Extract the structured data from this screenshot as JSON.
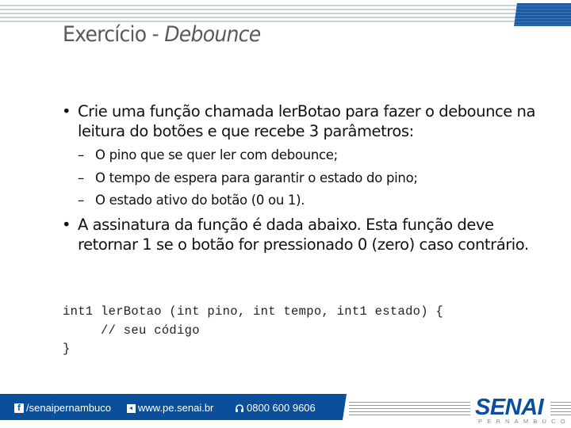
{
  "slide": {
    "title_prefix": "Exercício - ",
    "title_emphasis": "Debounce",
    "bullets": [
      {
        "symbol": "•",
        "text": "Crie uma função chamada lerBotao para fazer o debounce na leitura do botões e que recebe 3 parâmetros:",
        "subitems": [
          "O pino que se quer ler com debounce;",
          "O tempo de espera para garantir o estado do pino;",
          "O estado ativo do botão (0 ou 1)."
        ]
      },
      {
        "symbol": "•",
        "text": "A assinatura da função é dada abaixo. Esta função deve retornar 1 se o botão for pressionado 0 (zero) caso contrário."
      }
    ],
    "sub_symbol": "–",
    "code_lines": [
      "int1 lerBotao (int pino, int tempo, int1 estado) {",
      "     // seu código",
      "}"
    ]
  },
  "footer": {
    "facebook": {
      "icon": "facebook-icon",
      "glyph": "f",
      "label": "/senaipernambuco"
    },
    "website": {
      "icon": "web-icon",
      "label": "www.pe.senai.br"
    },
    "phone": {
      "icon": "headset-icon",
      "label": "0800 600 9606"
    },
    "logo": {
      "name": "SENAI",
      "subtitle": "PERNAMBUCO"
    }
  },
  "colors": {
    "brand_blue": "#0a4f9c",
    "stripe_grey": "#c8d3d6",
    "title_grey": "#595959"
  }
}
